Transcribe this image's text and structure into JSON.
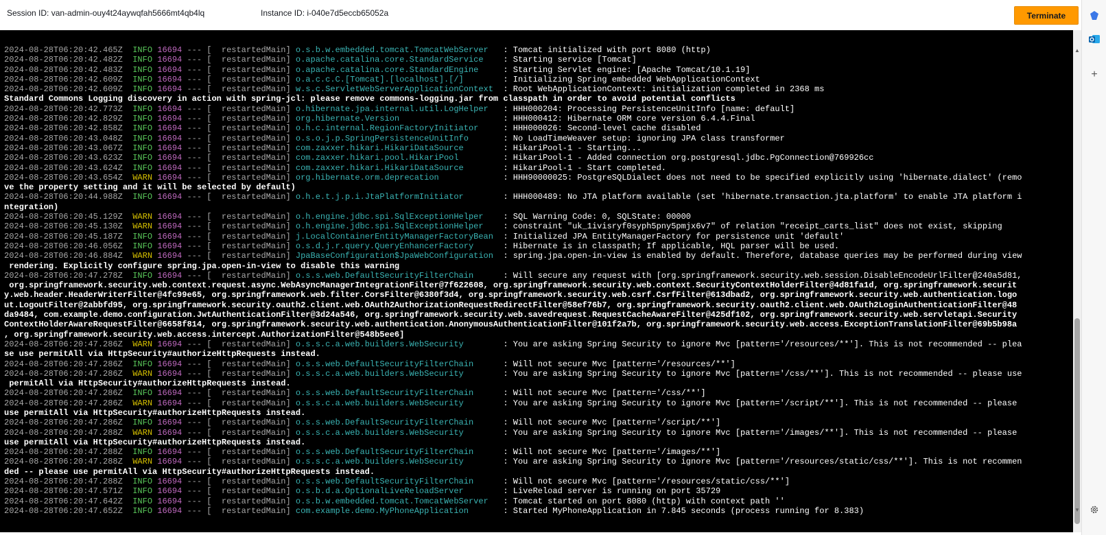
{
  "header": {
    "session_id": "Session ID: van-admin-ouy4t24aywqfah5666mt4qb4lq",
    "instance_id": "Instance ID: i-040e7d5eccb65052a",
    "terminate_label": "Terminate"
  },
  "colors": {
    "accent": "#ff9900",
    "terminal_bg": "#000000",
    "info": "#5ac85a",
    "warn": "#d6c000",
    "pid": "#c06ac0",
    "logger": "#3ab4b4"
  },
  "sidebar": {
    "icons": [
      "bookmark-icon",
      "outlook-icon",
      "add-icon",
      "settings-icon"
    ]
  },
  "log": [
    {
      "ts": "2024-08-28T06:20:42.465Z",
      "level": "INFO",
      "pid": "16694",
      "thread": "restartedMain",
      "logger": "o.s.b.w.embedded.tomcat.TomcatWebServer  ",
      "msg": "Tomcat initialized with port 8080 (http)"
    },
    {
      "ts": "2024-08-28T06:20:42.482Z",
      "level": "INFO",
      "pid": "16694",
      "thread": "restartedMain",
      "logger": "o.apache.catalina.core.StandardService   ",
      "msg": "Starting service [Tomcat]"
    },
    {
      "ts": "2024-08-28T06:20:42.483Z",
      "level": "INFO",
      "pid": "16694",
      "thread": "restartedMain",
      "logger": "o.apache.catalina.core.StandardEngine    ",
      "msg": "Starting Servlet engine: [Apache Tomcat/10.1.19]"
    },
    {
      "ts": "2024-08-28T06:20:42.609Z",
      "level": "INFO",
      "pid": "16694",
      "thread": "restartedMain",
      "logger": "o.a.c.c.C.[Tomcat].[localhost].[/]       ",
      "msg": "Initializing Spring embedded WebApplicationContext"
    },
    {
      "ts": "2024-08-28T06:20:42.609Z",
      "level": "INFO",
      "pid": "16694",
      "thread": "restartedMain",
      "logger": "w.s.c.ServletWebServerApplicationContext ",
      "msg": "Root WebApplicationContext: initialization completed in 2368 ms"
    },
    {
      "text": "Standard Commons Logging discovery in action with spring-jcl: please remove commons-logging.jar from classpath in order to avoid potential conflicts"
    },
    {
      "ts": "2024-08-28T06:20:42.773Z",
      "level": "INFO",
      "pid": "16694",
      "thread": "restartedMain",
      "logger": "o.hibernate.jpa.internal.util.LogHelper  ",
      "msg": "HHH000204: Processing PersistenceUnitInfo [name: default]"
    },
    {
      "ts": "2024-08-28T06:20:42.829Z",
      "level": "INFO",
      "pid": "16694",
      "thread": "restartedMain",
      "logger": "org.hibernate.Version                    ",
      "msg": "HHH000412: Hibernate ORM core version 6.4.4.Final"
    },
    {
      "ts": "2024-08-28T06:20:42.858Z",
      "level": "INFO",
      "pid": "16694",
      "thread": "restartedMain",
      "logger": "o.h.c.internal.RegionFactoryInitiator    ",
      "msg": "HHH000026: Second-level cache disabled"
    },
    {
      "ts": "2024-08-28T06:20:43.048Z",
      "level": "INFO",
      "pid": "16694",
      "thread": "restartedMain",
      "logger": "o.s.o.j.p.SpringPersistenceUnitInfo      ",
      "msg": "No LoadTimeWeaver setup: ignoring JPA class transformer"
    },
    {
      "ts": "2024-08-28T06:20:43.067Z",
      "level": "INFO",
      "pid": "16694",
      "thread": "restartedMain",
      "logger": "com.zaxxer.hikari.HikariDataSource       ",
      "msg": "HikariPool-1 - Starting..."
    },
    {
      "ts": "2024-08-28T06:20:43.623Z",
      "level": "INFO",
      "pid": "16694",
      "thread": "restartedMain",
      "logger": "com.zaxxer.hikari.pool.HikariPool        ",
      "msg": "HikariPool-1 - Added connection org.postgresql.jdbc.PgConnection@769926cc"
    },
    {
      "ts": "2024-08-28T06:20:43.624Z",
      "level": "INFO",
      "pid": "16694",
      "thread": "restartedMain",
      "logger": "com.zaxxer.hikari.HikariDataSource       ",
      "msg": "HikariPool-1 - Start completed."
    },
    {
      "ts": "2024-08-28T06:20:43.654Z",
      "level": "WARN",
      "pid": "16694",
      "thread": "restartedMain",
      "logger": "org.hibernate.orm.deprecation            ",
      "msg": "HHH90000025: PostgreSQLDialect does not need to be specified explicitly using 'hibernate.dialect' (remo"
    },
    {
      "text": "ve the property setting and it will be selected by default)"
    },
    {
      "ts": "2024-08-28T06:20:44.988Z",
      "level": "INFO",
      "pid": "16694",
      "thread": "restartedMain",
      "logger": "o.h.e.t.j.p.i.JtaPlatformInitiator       ",
      "msg": "HHH000489: No JTA platform available (set 'hibernate.transaction.jta.platform' to enable JTA platform i"
    },
    {
      "text": "ntegration)"
    },
    {
      "ts": "2024-08-28T06:20:45.129Z",
      "level": "WARN",
      "pid": "16694",
      "thread": "restartedMain",
      "logger": "o.h.engine.jdbc.spi.SqlExceptionHelper   ",
      "msg": "SQL Warning Code: 0, SQLState: 00000"
    },
    {
      "ts": "2024-08-28T06:20:45.130Z",
      "level": "WARN",
      "pid": "16694",
      "thread": "restartedMain",
      "logger": "o.h.engine.jdbc.spi.SqlExceptionHelper   ",
      "msg": "constraint \"uk_1ivisryf0syph5pny5pmjx6v7\" of relation \"receipt_carts_list\" does not exist, skipping"
    },
    {
      "ts": "2024-08-28T06:20:45.187Z",
      "level": "INFO",
      "pid": "16694",
      "thread": "restartedMain",
      "logger": "j.LocalContainerEntityManagerFactoryBean ",
      "msg": "Initialized JPA EntityManagerFactory for persistence unit 'default'"
    },
    {
      "ts": "2024-08-28T06:20:46.056Z",
      "level": "INFO",
      "pid": "16694",
      "thread": "restartedMain",
      "logger": "o.s.d.j.r.query.QueryEnhancerFactory     ",
      "msg": "Hibernate is in classpath; If applicable, HQL parser will be used."
    },
    {
      "ts": "2024-08-28T06:20:46.884Z",
      "level": "WARN",
      "pid": "16694",
      "thread": "restartedMain",
      "logger": "JpaBaseConfiguration$JpaWebConfiguration ",
      "msg": "spring.jpa.open-in-view is enabled by default. Therefore, database queries may be performed during view"
    },
    {
      "text": " rendering. Explicitly configure spring.jpa.open-in-view to disable this warning"
    },
    {
      "ts": "2024-08-28T06:20:47.278Z",
      "level": "INFO",
      "pid": "16694",
      "thread": "restartedMain",
      "logger": "o.s.s.web.DefaultSecurityFilterChain     ",
      "msg": "Will secure any request with [org.springframework.security.web.session.DisableEncodeUrlFilter@240a5d81,"
    },
    {
      "text": " org.springframework.security.web.context.request.async.WebAsyncManagerIntegrationFilter@7f622608, org.springframework.security.web.context.SecurityContextHolderFilter@4d81fa1d, org.springframework.securit"
    },
    {
      "text": "y.web.header.HeaderWriterFilter@4fc99e65, org.springframework.web.filter.CorsFilter@6380f3d4, org.springframework.security.web.csrf.CsrfFilter@613dbad2, org.springframework.security.web.authentication.logo"
    },
    {
      "text": "ut.LogoutFilter@2abbfd95, org.springframework.security.oauth2.client.web.OAuth2AuthorizationRequestRedirectFilter@58ef76b7, org.springframework.security.oauth2.client.web.OAuth2LoginAuthenticationFilter@48"
    },
    {
      "text": "da9484, com.example.demo.configuration.JwtAuthenticationFilter@3d24a546, org.springframework.security.web.savedrequest.RequestCacheAwareFilter@425df102, org.springframework.security.web.servletapi.Security"
    },
    {
      "text": "ContextHolderAwareRequestFilter@6658f814, org.springframework.security.web.authentication.AnonymousAuthenticationFilter@101f2a7b, org.springframework.security.web.access.ExceptionTranslationFilter@69b5b98a"
    },
    {
      "text": ", org.springframework.security.web.access.intercept.AuthorizationFilter@548b5ee6]"
    },
    {
      "ts": "2024-08-28T06:20:47.286Z",
      "level": "WARN",
      "pid": "16694",
      "thread": "restartedMain",
      "logger": "o.s.s.c.a.web.builders.WebSecurity       ",
      "msg": "You are asking Spring Security to ignore Mvc [pattern='/resources/**']. This is not recommended -- plea"
    },
    {
      "text": "se use permitAll via HttpSecurity#authorizeHttpRequests instead."
    },
    {
      "ts": "2024-08-28T06:20:47.286Z",
      "level": "INFO",
      "pid": "16694",
      "thread": "restartedMain",
      "logger": "o.s.s.web.DefaultSecurityFilterChain     ",
      "msg": "Will not secure Mvc [pattern='/resources/**']"
    },
    {
      "ts": "2024-08-28T06:20:47.286Z",
      "level": "WARN",
      "pid": "16694",
      "thread": "restartedMain",
      "logger": "o.s.s.c.a.web.builders.WebSecurity       ",
      "msg": "You are asking Spring Security to ignore Mvc [pattern='/css/**']. This is not recommended -- please use"
    },
    {
      "text": " permitAll via HttpSecurity#authorizeHttpRequests instead."
    },
    {
      "ts": "2024-08-28T06:20:47.286Z",
      "level": "INFO",
      "pid": "16694",
      "thread": "restartedMain",
      "logger": "o.s.s.web.DefaultSecurityFilterChain     ",
      "msg": "Will not secure Mvc [pattern='/css/**']"
    },
    {
      "ts": "2024-08-28T06:20:47.286Z",
      "level": "WARN",
      "pid": "16694",
      "thread": "restartedMain",
      "logger": "o.s.s.c.a.web.builders.WebSecurity       ",
      "msg": "You are asking Spring Security to ignore Mvc [pattern='/script/**']. This is not recommended -- please"
    },
    {
      "text": "use permitAll via HttpSecurity#authorizeHttpRequests instead."
    },
    {
      "ts": "2024-08-28T06:20:47.286Z",
      "level": "INFO",
      "pid": "16694",
      "thread": "restartedMain",
      "logger": "o.s.s.web.DefaultSecurityFilterChain     ",
      "msg": "Will not secure Mvc [pattern='/script/**']"
    },
    {
      "ts": "2024-08-28T06:20:47.288Z",
      "level": "WARN",
      "pid": "16694",
      "thread": "restartedMain",
      "logger": "o.s.s.c.a.web.builders.WebSecurity       ",
      "msg": "You are asking Spring Security to ignore Mvc [pattern='/images/**']. This is not recommended -- please"
    },
    {
      "text": "use permitAll via HttpSecurity#authorizeHttpRequests instead."
    },
    {
      "ts": "2024-08-28T06:20:47.288Z",
      "level": "INFO",
      "pid": "16694",
      "thread": "restartedMain",
      "logger": "o.s.s.web.DefaultSecurityFilterChain     ",
      "msg": "Will not secure Mvc [pattern='/images/**']"
    },
    {
      "ts": "2024-08-28T06:20:47.288Z",
      "level": "WARN",
      "pid": "16694",
      "thread": "restartedMain",
      "logger": "o.s.s.c.a.web.builders.WebSecurity       ",
      "msg": "You are asking Spring Security to ignore Mvc [pattern='/resources/static/css/**']. This is not recommen"
    },
    {
      "text": "ded -- please use permitAll via HttpSecurity#authorizeHttpRequests instead."
    },
    {
      "ts": "2024-08-28T06:20:47.288Z",
      "level": "INFO",
      "pid": "16694",
      "thread": "restartedMain",
      "logger": "o.s.s.web.DefaultSecurityFilterChain     ",
      "msg": "Will not secure Mvc [pattern='/resources/static/css/**']"
    },
    {
      "ts": "2024-08-28T06:20:47.571Z",
      "level": "INFO",
      "pid": "16694",
      "thread": "restartedMain",
      "logger": "o.s.b.d.a.OptionalLiveReloadServer       ",
      "msg": "LiveReload server is running on port 35729"
    },
    {
      "ts": "2024-08-28T06:20:47.642Z",
      "level": "INFO",
      "pid": "16694",
      "thread": "restartedMain",
      "logger": "o.s.b.w.embedded.tomcat.TomcatWebServer  ",
      "msg": "Tomcat started on port 8080 (http) with context path ''"
    },
    {
      "ts": "2024-08-28T06:20:47.652Z",
      "level": "INFO",
      "pid": "16694",
      "thread": "restartedMain",
      "logger": "com.example.demo.MyPhoneApplication      ",
      "msg": "Started MyPhoneApplication in 7.845 seconds (process running for 8.383)"
    }
  ]
}
